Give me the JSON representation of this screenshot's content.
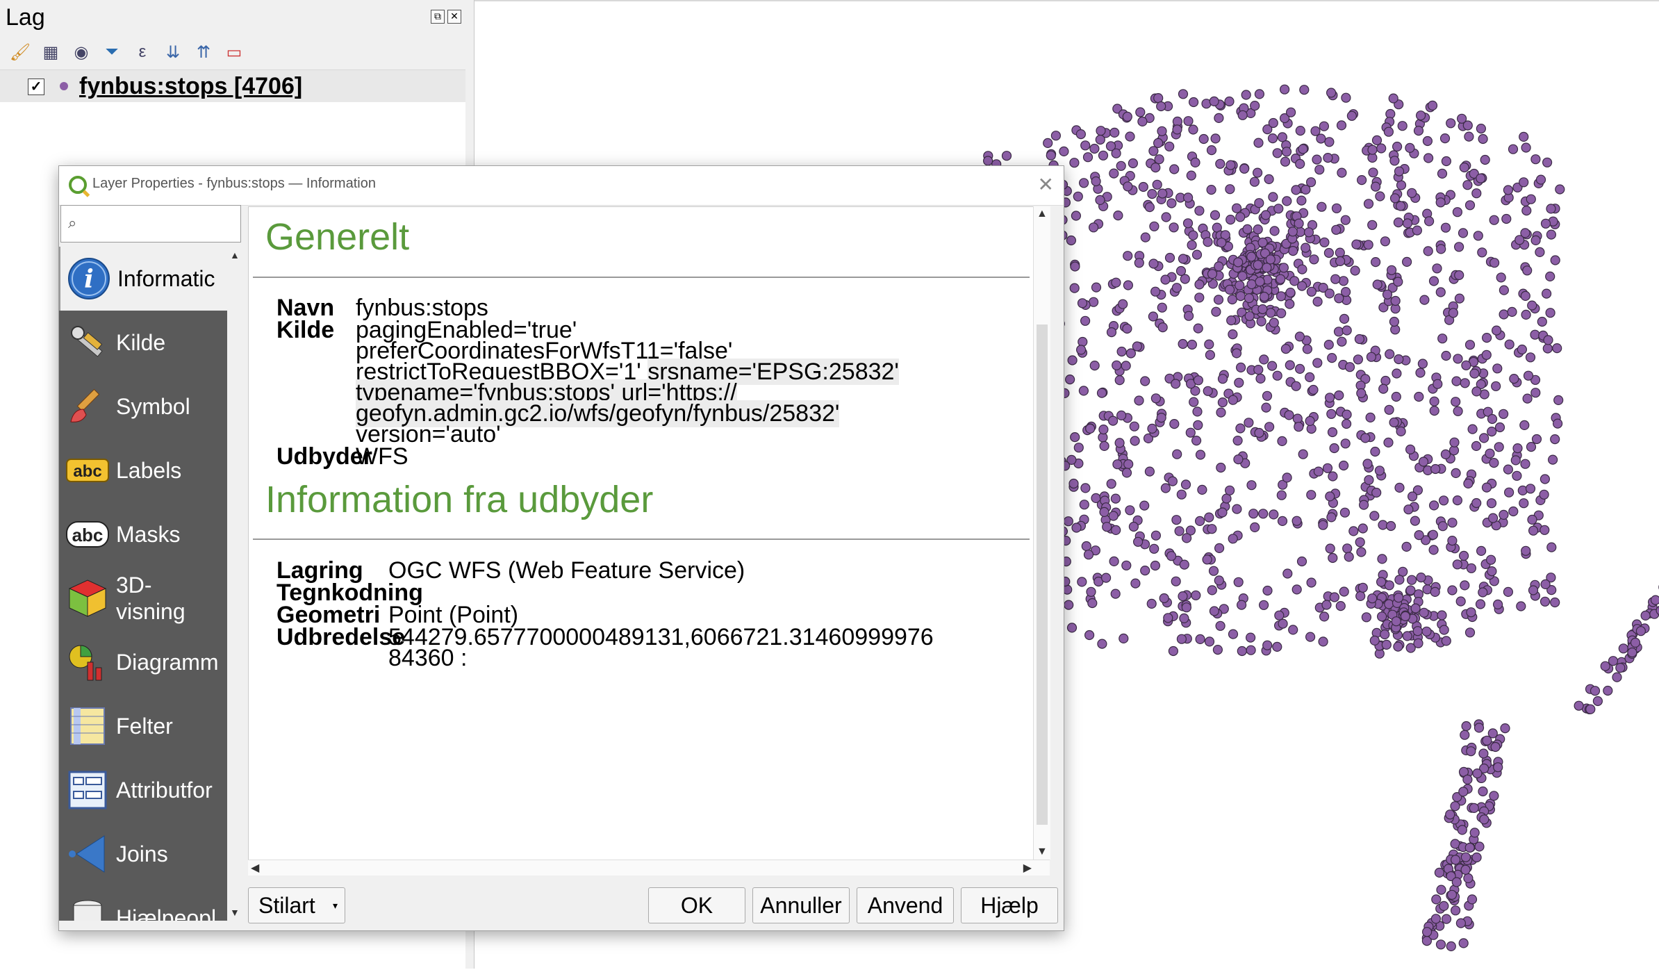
{
  "layers_panel": {
    "title": "Lag",
    "toolbar_icons": [
      "paint-brush-icon",
      "add-group-icon",
      "eye-icon",
      "filter-icon",
      "expression-filter-icon",
      "expand-all-icon",
      "collapse-all-icon",
      "remove-layer-icon"
    ],
    "layer": {
      "name": "fynbus:stops [4706]",
      "checked": "✓",
      "color": "#8c5ea6"
    }
  },
  "dialog": {
    "title": "Layer Properties - fynbus:stops — Information",
    "close": "✕",
    "search_placeholder": "",
    "sidebar": [
      {
        "label": "Informatic",
        "icon": "info-icon"
      },
      {
        "label": "Kilde",
        "icon": "tools-icon"
      },
      {
        "label": "Symbol",
        "icon": "paint-brush-icon"
      },
      {
        "label": "Labels",
        "icon": "labels-abc-icon"
      },
      {
        "label": "Masks",
        "icon": "masks-abc-icon"
      },
      {
        "label": "3D-\nvisning",
        "icon": "cube-3d-icon"
      },
      {
        "label": "Diagramm",
        "icon": "diagram-icon"
      },
      {
        "label": "Felter",
        "icon": "fields-icon"
      },
      {
        "label": "Attributfor",
        "icon": "attribute-form-icon"
      },
      {
        "label": "Joins",
        "icon": "joins-icon"
      },
      {
        "label": "Hjælpeopl",
        "icon": "auxiliary-storage-icon"
      }
    ],
    "general": {
      "heading": "Generelt",
      "name_label": "Navn",
      "name_value": "fynbus:stops",
      "source_label": "Kilde",
      "source_lines": [
        "pagingEnabled='true'",
        "preferCoordinatesForWfsT11='false'",
        "restrictToRequestBBOX='1'",
        "srsname='EPSG:25832'",
        "typename='fynbus:stops' url='https://",
        "geofyn.admin.gc2.io/wfs/geofyn/fynbus/25832'",
        "version='auto'"
      ],
      "provider_label": "Udbyder",
      "provider_value": "WFS"
    },
    "provider_info": {
      "heading": "Information fra udbyder",
      "storage_label": "Lagring",
      "storage_value": "OGC WFS (Web Feature Service)",
      "encoding_label": "Tegnkodning",
      "encoding_value": "",
      "geometry_label": "Geometri",
      "geometry_value": "Point (Point)",
      "extent_label": "Udbredelse",
      "extent_line1": "544279.6577700000489131,6066721.31460999976",
      "extent_line2": "84360 :"
    },
    "buttons": {
      "style": "Stilart",
      "ok": "OK",
      "cancel": "Annuller",
      "apply": "Anvend",
      "help": "Hjælp"
    }
  },
  "map": {
    "point_color": "#8c5ea6",
    "stroke_color": "#3a2a44"
  }
}
